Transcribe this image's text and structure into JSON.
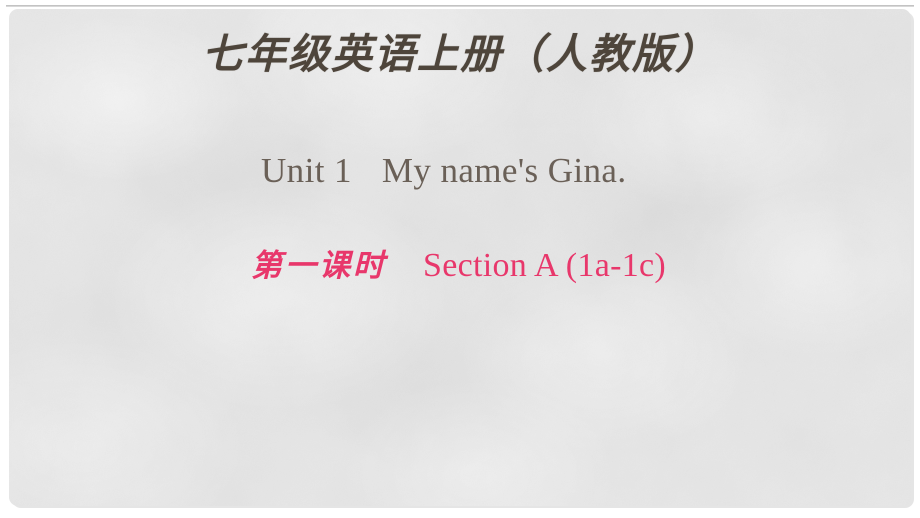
{
  "slide": {
    "background_color": "#e7e7e7",
    "page_color": "#ffffff",
    "book_title": "七年级英语上册（人教版）",
    "book_title_color": "#4e453b",
    "unit_heading": {
      "unit_label": "Unit 1",
      "unit_title": "My name's Gina.",
      "color": "#6a6057"
    },
    "period_heading": {
      "period_label": "第一课时",
      "section_label": "Section A (1a-1c)",
      "color": "#e8376b"
    }
  }
}
